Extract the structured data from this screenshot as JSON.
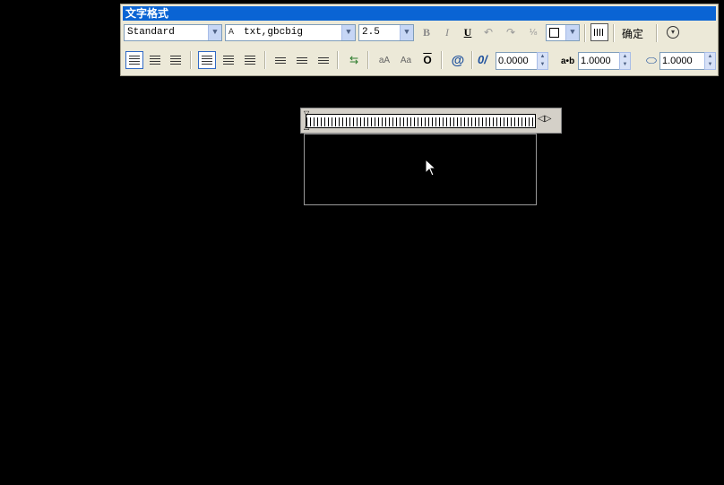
{
  "toolbar": {
    "title": "文字格式",
    "style": "Standard",
    "font": "txt,gbcbig",
    "height": "2.5",
    "bold": "B",
    "italic": "I",
    "underline": "U",
    "ok_label": "确定",
    "oblique_value": "0.0000",
    "tracking_value": "1.0000",
    "width_value": "1.0000",
    "oblique_label": "0/",
    "tracking_label": "a•b",
    "at_label": "@"
  },
  "ruler": {
    "arrows": "◁▷"
  },
  "colors": {
    "titlebar": "#0a64d4",
    "toolbar_bg": "#ece9d8",
    "canvas": "#000000"
  }
}
